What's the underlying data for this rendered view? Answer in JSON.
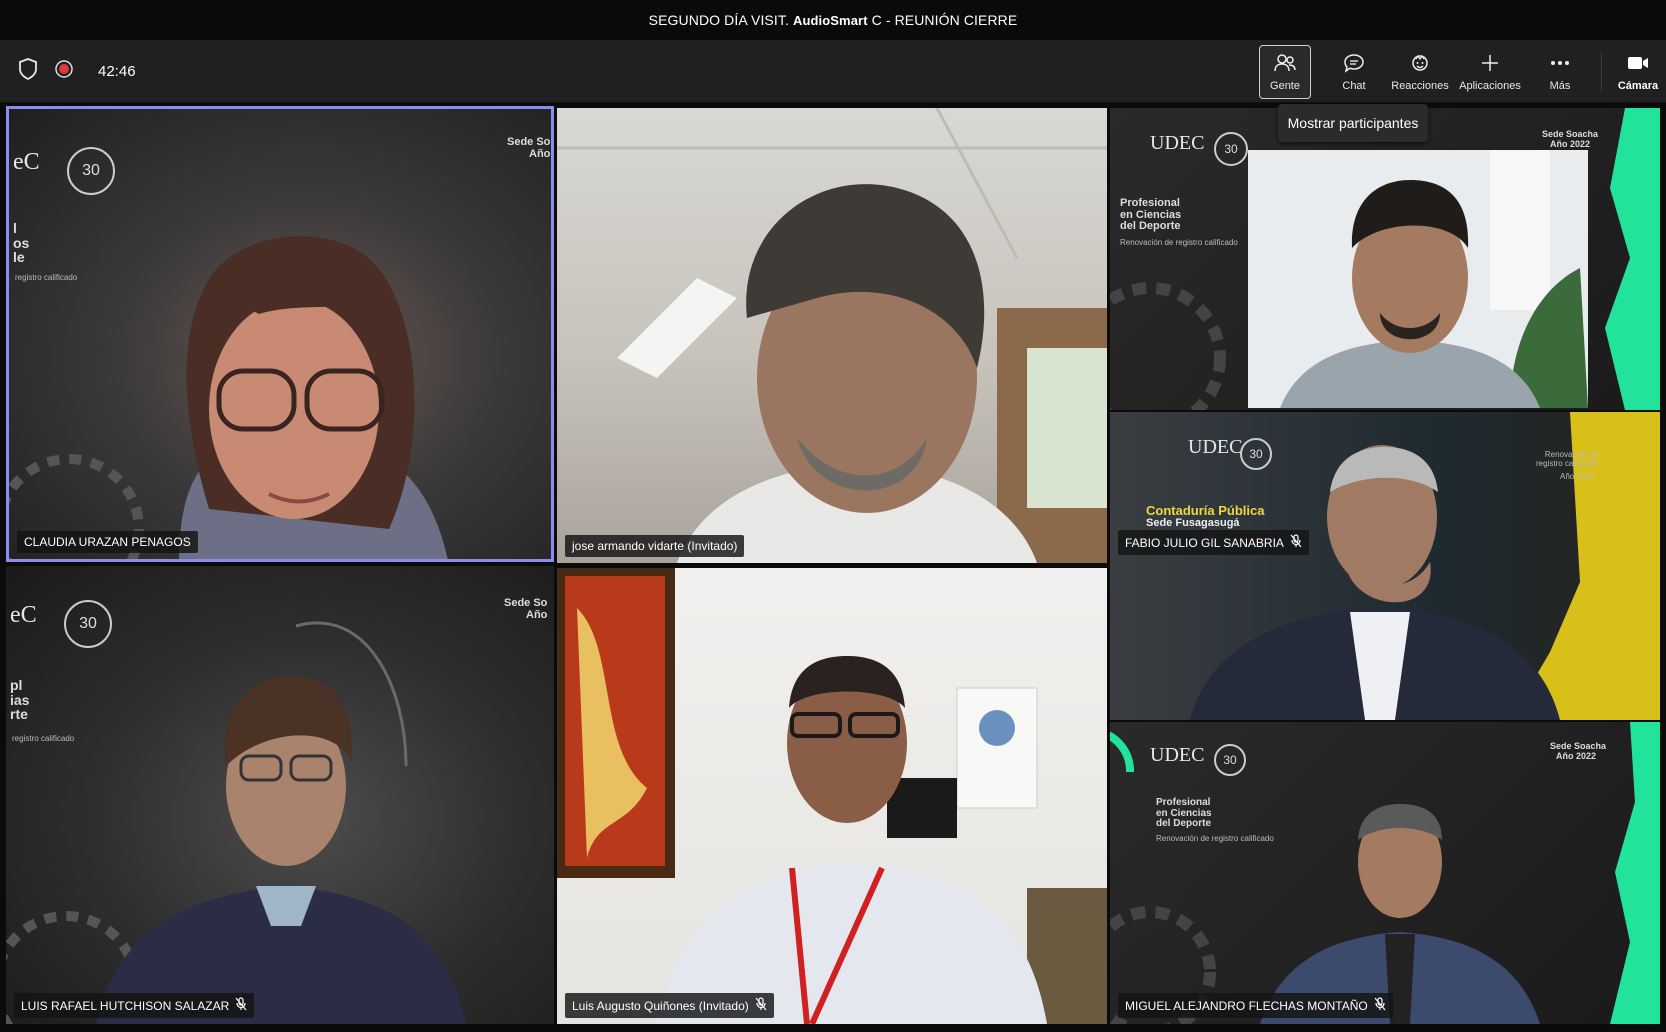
{
  "title_bar": {
    "prefix": "SEGUNDO DÍA VISIT.",
    "overlay": "AudioSmart",
    "suffix": "C - REUNIÓN CIERRE"
  },
  "toolbar": {
    "timer": "42:46",
    "buttons": [
      {
        "label": "Gente",
        "icon": "people-icon"
      },
      {
        "label": "Chat",
        "icon": "chat-icon"
      },
      {
        "label": "Reacciones",
        "icon": "reactions-icon"
      },
      {
        "label": "Aplicaciones",
        "icon": "plus-icon"
      },
      {
        "label": "Más",
        "icon": "more-icon"
      },
      {
        "label": "Cámara",
        "icon": "camera-icon"
      }
    ]
  },
  "tooltip": "Mostrar participantes",
  "participants": [
    {
      "name": "CLAUDIA URAZAN PENAGOS",
      "muted": false
    },
    {
      "name": "jose armando vidarte (Invitado)",
      "muted": false
    },
    {
      "name": "",
      "muted": false
    },
    {
      "name": "FABIO JULIO GIL SANABRIA",
      "muted": true
    },
    {
      "name": "LUIS RAFAEL HUTCHISON SALAZAR",
      "muted": true
    },
    {
      "name": "Luis Augusto Quiñones (Invitado)",
      "muted": true
    },
    {
      "name": "MIGUEL ALEJANDRO FLECHAS MONTAÑO",
      "muted": true
    }
  ],
  "backgrounds": {
    "tile1": {
      "logo": "eC",
      "sede": "Sede So",
      "anio": "Año",
      "letters": "l\nos\nle",
      "registro": "registro calificado"
    },
    "tile3": {
      "logo": "UDEC",
      "program": "Profesional\nen Ciencias\ndel Deporte",
      "renovacion": "Renovación de registro calificado",
      "sede": "Sede Soacha",
      "anio": "Año 2022"
    },
    "tile4": {
      "logo": "UDEC",
      "program": "Contaduría Pública",
      "sede": "Sede Fusagasugá",
      "renovacion": "Renovación de\nregistro calificado",
      "anio": "Año 2022"
    },
    "tile5": {
      "logo": "eC",
      "sede": "Sede So",
      "anio": "Año",
      "letters": "pl\nias\nrte",
      "registro": "registro calificado"
    },
    "tile7": {
      "logo": "UDEC",
      "program": "Profesional\nen Ciencias\ndel Deporte",
      "renovacion": "Renovación de registro calificado",
      "sede": "Sede Soacha",
      "anio": "Año 2022"
    }
  },
  "colors": {
    "active_speaker_border": "#8b8cf0",
    "accent_green": "#22e39a",
    "accent_yellow": "#d8c018",
    "recording": "#e0393e"
  }
}
